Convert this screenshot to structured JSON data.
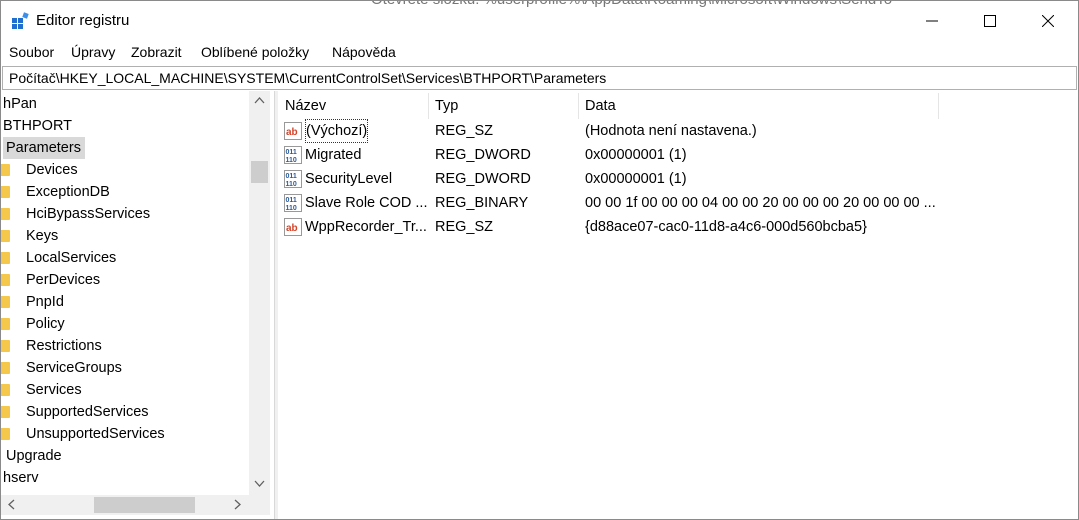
{
  "window": {
    "title": "Editor registru",
    "behind_text": "Otevřete složku: %userprofile%\\AppData\\Roaming\\Microsoft\\Windows\\SendTo"
  },
  "menu": [
    "Soubor",
    "Úpravy",
    "Zobrazit",
    "Oblíbené položky",
    "Nápověda"
  ],
  "address": "Počítač\\HKEY_LOCAL_MACHINE\\SYSTEM\\CurrentControlSet\\Services\\BTHPORT\\Parameters",
  "tree": {
    "items": [
      {
        "label": "hPan",
        "folder": false,
        "selected": false
      },
      {
        "label": "BTHPORT",
        "folder": false,
        "selected": false
      },
      {
        "label": "Parameters",
        "folder": false,
        "selected": true
      },
      {
        "label": "Devices",
        "folder": true
      },
      {
        "label": "ExceptionDB",
        "folder": true
      },
      {
        "label": "HciBypassServices",
        "folder": true
      },
      {
        "label": "Keys",
        "folder": true
      },
      {
        "label": "LocalServices",
        "folder": true
      },
      {
        "label": "PerDevices",
        "folder": true
      },
      {
        "label": "PnpId",
        "folder": true
      },
      {
        "label": "Policy",
        "folder": true
      },
      {
        "label": "Restrictions",
        "folder": true
      },
      {
        "label": "ServiceGroups",
        "folder": true
      },
      {
        "label": "Services",
        "folder": true
      },
      {
        "label": "SupportedServices",
        "folder": true
      },
      {
        "label": "UnsupportedServices",
        "folder": true
      },
      {
        "label": "Upgrade",
        "folder": false,
        "selected": false
      },
      {
        "label": "hserv",
        "folder": false,
        "selected": false
      }
    ]
  },
  "list": {
    "columns": [
      "Název",
      "Typ",
      "Data"
    ],
    "rows": [
      {
        "icon": "string-value-icon",
        "name": "(Výchozí)",
        "type": "REG_SZ",
        "data": "(Hodnota není nastavena.)"
      },
      {
        "icon": "binary-value-icon",
        "name": "Migrated",
        "type": "REG_DWORD",
        "data": "0x00000001 (1)"
      },
      {
        "icon": "binary-value-icon",
        "name": "SecurityLevel",
        "type": "REG_DWORD",
        "data": "0x00000001 (1)"
      },
      {
        "icon": "binary-value-icon",
        "name": "Slave Role COD ...",
        "type": "REG_BINARY",
        "data": "00 00 1f 00 00 00 04 00 00 20 00 00 00 20 00 00 00 ..."
      },
      {
        "icon": "string-value-icon",
        "name": "WppRecorder_Tr...",
        "type": "REG_SZ",
        "data": "{d88ace07-cac0-11d8-a4c6-000d560bcba5}"
      }
    ]
  },
  "colors": {
    "selection": "#d9d9d9",
    "folder": "#f5c84c",
    "string_icon": "#d2452b",
    "binary_icon": "#2a5a9e"
  }
}
